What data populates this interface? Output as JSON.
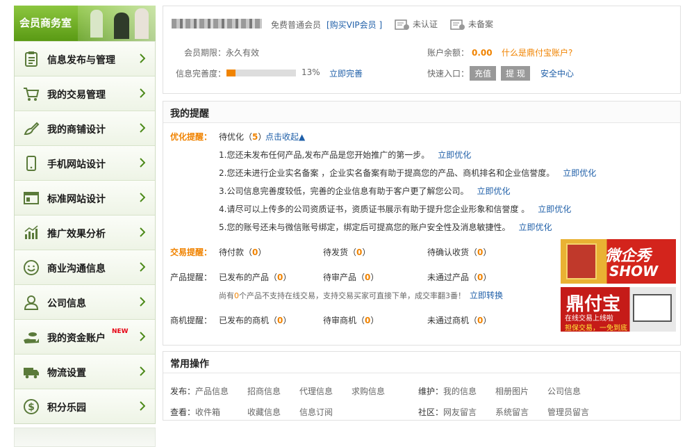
{
  "sidebar": {
    "title": "会员商务室",
    "items": [
      {
        "label": "信息发布与管理",
        "icon": "clipboard-icon"
      },
      {
        "label": "我的交易管理",
        "icon": "cart-icon"
      },
      {
        "label": "我的商铺设计",
        "icon": "brush-icon"
      },
      {
        "label": "手机网站设计",
        "icon": "mobile-icon"
      },
      {
        "label": "标准网站设计",
        "icon": "browser-window-icon"
      },
      {
        "label": "推广效果分析",
        "icon": "bar-chart-icon"
      },
      {
        "label": "商业沟通信息",
        "icon": "smiley-icon"
      },
      {
        "label": "公司信息",
        "icon": "user-icon"
      },
      {
        "label": "我的资金账户",
        "icon": "hand-money-icon",
        "badge": "NEW"
      },
      {
        "label": "物流设置",
        "icon": "truck-icon"
      },
      {
        "label": "积分乐园",
        "icon": "coin-icon"
      }
    ]
  },
  "account": {
    "member_type": "免费普通会员",
    "buy_vip": "[购买VIP会员 ]",
    "not_certified": "未认证",
    "not_filed": "未备案",
    "period_label": "会员期限：",
    "period_value": "永久有效",
    "balance_label": "账户余额：",
    "balance_value": "0.00",
    "what_is": "什么是鼎付宝账户?",
    "completeness_label": "信息完善度：",
    "completeness_percent": "13%",
    "completeness_fraction": 0.13,
    "complete_now": "立即完善",
    "quick_label": "快速入口：",
    "recharge": "充值",
    "withdraw": "提 现",
    "security": "安全中心"
  },
  "reminders": {
    "title": "我的提醒",
    "optimize_label": "优化提醒：",
    "pending_prefix": "待优化（",
    "pending_count": "5",
    "pending_suffix": "）",
    "collapse": "点击收起▲",
    "items": [
      {
        "text": "1.您还未发布任何产品,发布产品是您开始推广的第一步。",
        "link": "立即优化"
      },
      {
        "text": "2.您还未进行企业实名备案 ，企业实名备案有助于提高您的产品、商机排名和企业信誉度。",
        "link": "立即优化"
      },
      {
        "text": "3.公司信息完善度较低，完善的企业信息有助于客户更了解您公司。",
        "link": "立即优化"
      },
      {
        "text": "4.请尽可以上传多的公司资质证书，资质证书展示有助于提升您企业形象和信誉度 。",
        "link": "立即优化"
      },
      {
        "text": "5.您的账号还未与微信账号绑定，绑定后可提高您的账户安全性及消息敏捷性。",
        "link": "立即优化"
      }
    ],
    "trade_label": "交易提醒：",
    "trade": [
      {
        "label": "待付款（",
        "count": "0",
        "end": "）"
      },
      {
        "label": "待发货（",
        "count": "0",
        "end": "）"
      },
      {
        "label": "待确认收货（",
        "count": "0",
        "end": "）"
      }
    ],
    "product_label": "产品提醒：",
    "product": [
      {
        "label": "已发布的产品（",
        "count": "0",
        "end": "）"
      },
      {
        "label": "待审产品（",
        "count": "0",
        "end": "）"
      },
      {
        "label": "未通过产品（",
        "count": "0",
        "end": "）"
      }
    ],
    "notice_prefix": "尚有",
    "notice_count": "0",
    "notice_suffix": "个产品不支持在线交易，支持交易买家可直接下单，成交率翻3番！",
    "convert_now": "立即转换",
    "biz_label": "商机提醒：",
    "biz": [
      {
        "label": "已发布的商机（",
        "count": "0",
        "end": "）"
      },
      {
        "label": "待审商机（",
        "count": "0",
        "end": "）"
      },
      {
        "label": "未通过商机（",
        "count": "0",
        "end": "）"
      }
    ],
    "ad1": {
      "line1": "微企秀",
      "line2": "SHOW"
    },
    "ad2": {
      "line1": "鼎付宝",
      "line2": "在线交易上线啦",
      "line3": "担保交易，一免到底"
    }
  },
  "common": {
    "title": "常用操作",
    "publish_label": "发布：",
    "publish": [
      "产品信息",
      "招商信息",
      "代理信息",
      "求购信息"
    ],
    "maintain_label": "维护：",
    "maintain": [
      "我的信息",
      "相册图片",
      "公司信息"
    ],
    "view_label": "查看：",
    "view": [
      "收件箱",
      "收藏信息",
      "信息订阅"
    ],
    "community_label": "社区：",
    "community": [
      "网友留言",
      "系统留言",
      "管理员留言"
    ]
  },
  "colors": {
    "accent_orange": "#f08300",
    "link_blue": "#1f5fa8",
    "sidebar_green": "#6aa91e"
  }
}
